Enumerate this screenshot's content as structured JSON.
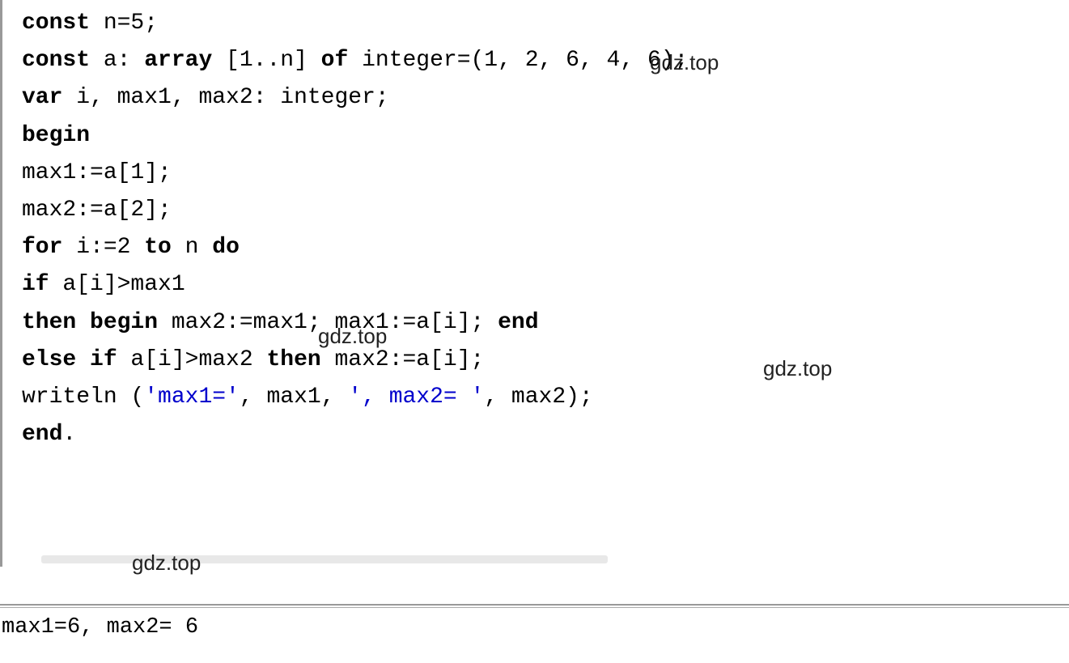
{
  "code": {
    "l1_kw1": "const",
    "l1_rest": " n=5;",
    "l2_kw1": "const",
    "l2_mid": " a: ",
    "l2_kw2": "array",
    "l2_rest": " [1..n] ",
    "l2_kw3": "of",
    "l2_end": " integer=(1, 2, 6, 4, 6);",
    "l3_kw1": "var",
    "l3_rest": " i, max1, max2: integer;",
    "l4_kw1": "begin",
    "l5": "max1:=a[1];",
    "l6": "max2:=a[2];",
    "l7_kw1": "for",
    "l7_mid1": " i:=2 ",
    "l7_kw2": "to",
    "l7_mid2": " n ",
    "l7_kw3": "do",
    "l8_kw1": "if",
    "l8_rest": " a[i]>max1",
    "l9_kw1": "then begin",
    "l9_mid": " max2:=max1; max1:=a[i]; ",
    "l9_kw2": "end",
    "l10_kw1": "else if",
    "l10_mid": " a[i]>max2 ",
    "l10_kw2": "then",
    "l10_rest": " max2:=a[i];",
    "l11_a": "writeln (",
    "l11_s1": "'max1='",
    "l11_b": ", max1, ",
    "l11_s2": "', max2= '",
    "l11_c": ", max2);",
    "l12_kw1": "end",
    "l12_rest": "."
  },
  "watermarks": {
    "w1": "gdz.top",
    "w2": "gdz.top",
    "w3": "gdz.top",
    "w4": "gdz.top"
  },
  "output": "max1=6, max2= 6"
}
